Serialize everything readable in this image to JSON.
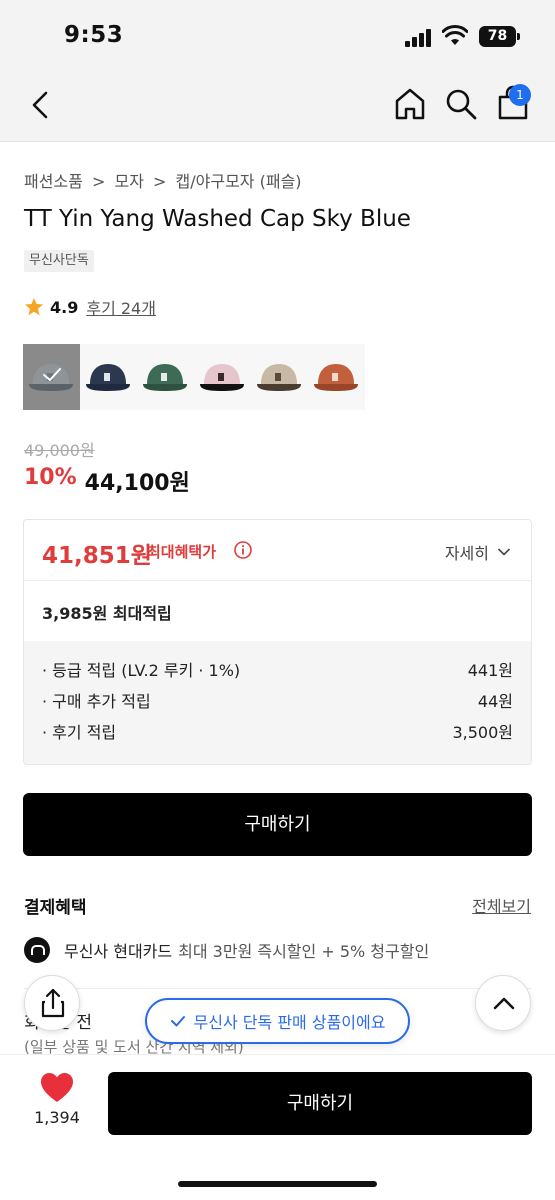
{
  "status_bar": {
    "time": "9:53",
    "battery": "78"
  },
  "header": {
    "cart_count": "1"
  },
  "product": {
    "breadcrumb": [
      "패션소품",
      ">",
      "모자",
      ">",
      "캡/야구모자 (패슬)"
    ],
    "title": "TT Yin Yang Washed Cap Sky Blue",
    "tag": "무신사단독",
    "rating": "4.9",
    "review_link": "후기 24개",
    "swatches": [
      {
        "color": "#8f9498",
        "accent": "#6e767c",
        "bill": "#5c6368"
      },
      {
        "color": "#2c3750",
        "accent": "#dfe6ee",
        "bill": "#1f2940"
      },
      {
        "color": "#3e6b55",
        "accent": "#e3ece8",
        "bill": "#2d5242"
      },
      {
        "color": "#e6c6cc",
        "accent": "#3a2a2a",
        "bill": "#111111"
      },
      {
        "color": "#c7b9a4",
        "accent": "#5a4a3a",
        "bill": "#4a3d30"
      },
      {
        "color": "#c2603d",
        "accent": "#f1d9cf",
        "bill": "#9a4528"
      }
    ],
    "original_price": "49,000원",
    "discount": "10%",
    "sale_price": "44,100원"
  },
  "benefits": {
    "max_price": "41,851원",
    "max_label": "최대혜택가",
    "detail": "자세히",
    "points": "3,985원 최대적립",
    "rows": [
      {
        "label": "· 등급 적립 (LV.2 루키 · 1%)",
        "value": "441원"
      },
      {
        "label": "· 구매 추가 적립",
        "value": "44원"
      },
      {
        "label": "· 후기 적립",
        "value": "3,500원"
      }
    ]
  },
  "buy_label": "구매하기",
  "payment": {
    "title": "결제혜택",
    "view_all": "전체보기",
    "card_name": "무신사 현대카드",
    "card_desc": "최대 3만원 즉시할인 + 5% 청구할인",
    "member_text": "회원은 전",
    "member_sub": "(일부 상품 및 도서 산간 지역 제외)"
  },
  "toast": "무신사 단독 판매 상품이에요",
  "bottom": {
    "like_count": "1,394",
    "buy_label": "구매하기"
  },
  "colors": {
    "accent_red": "#e03c3c",
    "accent_blue": "#2b6be8",
    "badge_blue": "#1e6ff0"
  }
}
